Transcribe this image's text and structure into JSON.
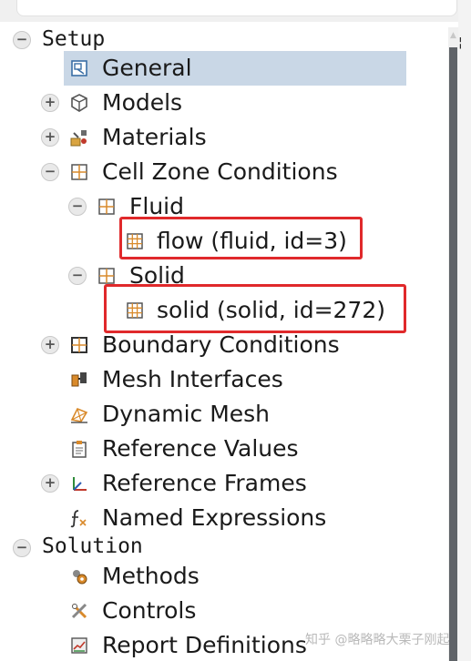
{
  "tree": {
    "setup": {
      "label": "Setup",
      "items": [
        {
          "label": "General",
          "icon": "general-icon"
        },
        {
          "label": "Models",
          "icon": "models-cube-icon"
        },
        {
          "label": "Materials",
          "icon": "materials-icon"
        },
        {
          "label": "Cell Zone Conditions",
          "icon": "grid-icon"
        },
        {
          "label": "Fluid",
          "icon": "grid-icon"
        },
        {
          "label": "flow (fluid, id=3)",
          "icon": "zone-grid-icon"
        },
        {
          "label": "Solid",
          "icon": "grid-icon"
        },
        {
          "label": "solid (solid, id=272)",
          "icon": "zone-grid-icon"
        },
        {
          "label": "Boundary Conditions",
          "icon": "grid-icon"
        },
        {
          "label": "Mesh Interfaces",
          "icon": "mesh-interfaces-icon"
        },
        {
          "label": "Dynamic Mesh",
          "icon": "dynamic-mesh-icon"
        },
        {
          "label": "Reference Values",
          "icon": "clipboard-icon"
        },
        {
          "label": "Reference Frames",
          "icon": "axes-icon"
        },
        {
          "label": "Named Expressions",
          "icon": "function-icon"
        }
      ]
    },
    "solution": {
      "label": "Solution",
      "items": [
        {
          "label": "Methods",
          "icon": "methods-icon"
        },
        {
          "label": "Controls",
          "icon": "controls-icon"
        },
        {
          "label": "Report Definitions",
          "icon": "report-icon"
        }
      ]
    }
  },
  "expander_symbols": {
    "collapse": "−",
    "expand": "+"
  },
  "watermark": "知乎 @略略略大栗子刚起",
  "colors": {
    "selected": "#c9d7e6",
    "highlight_box": "#e0292b"
  }
}
